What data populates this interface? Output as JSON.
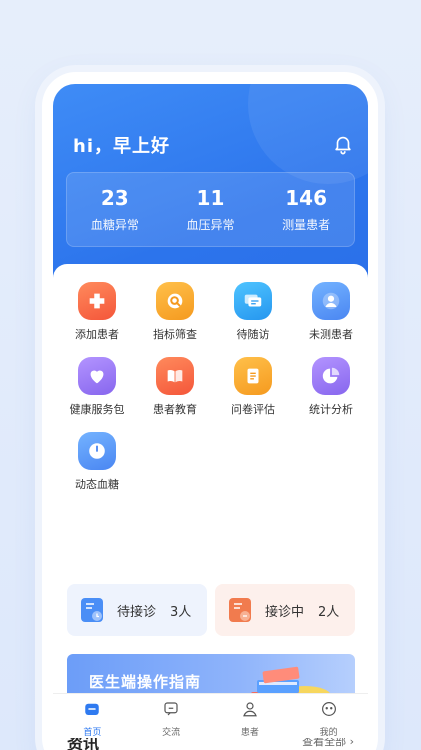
{
  "header": {
    "greeting": "hi，早上好",
    "stats": [
      {
        "value": "23",
        "label": "血糖异常"
      },
      {
        "value": "11",
        "label": "血压异常"
      },
      {
        "value": "146",
        "label": "测量患者"
      }
    ]
  },
  "menu": [
    {
      "label": "添加患者",
      "icon": "add-patient-icon",
      "color": "#f4673f"
    },
    {
      "label": "指标筛查",
      "icon": "search-icon",
      "color": "#f7a42a"
    },
    {
      "label": "待随访",
      "icon": "chat-icon",
      "color": "#34a8f3"
    },
    {
      "label": "未测患者",
      "icon": "user-icon",
      "color": "#5a9cf5"
    },
    {
      "label": "健康服务包",
      "icon": "heart-icon",
      "color": "#9b7bf2"
    },
    {
      "label": "患者教育",
      "icon": "book-icon",
      "color": "#f4673f"
    },
    {
      "label": "问卷评估",
      "icon": "document-icon",
      "color": "#f6a52c"
    },
    {
      "label": "统计分析",
      "icon": "pie-chart-icon",
      "color": "#9b7bf2"
    },
    {
      "label": "动态血糖",
      "icon": "clock-icon",
      "color": "#5a9cf5"
    }
  ],
  "queues": [
    {
      "label": "待接诊",
      "count": "3人",
      "bg": "#eef3fd",
      "iconColor": "#4a8ef6"
    },
    {
      "label": "接诊中",
      "count": "2人",
      "bg": "#fdf0ec",
      "iconColor": "#f17b4e"
    }
  ],
  "guide": {
    "title": "医生端操作指南"
  },
  "news": {
    "title": "资讯",
    "more": "查看全部"
  },
  "tabbar": [
    {
      "label": "首页",
      "icon": "home-icon",
      "active": true
    },
    {
      "label": "交流",
      "icon": "message-icon",
      "active": false
    },
    {
      "label": "患者",
      "icon": "patient-icon",
      "active": false
    },
    {
      "label": "我的",
      "icon": "profile-icon",
      "active": false
    }
  ],
  "colors": {
    "primary": "#2f7af0",
    "headerStart": "#3f8cf6",
    "headerEnd": "#2a6fe8"
  }
}
